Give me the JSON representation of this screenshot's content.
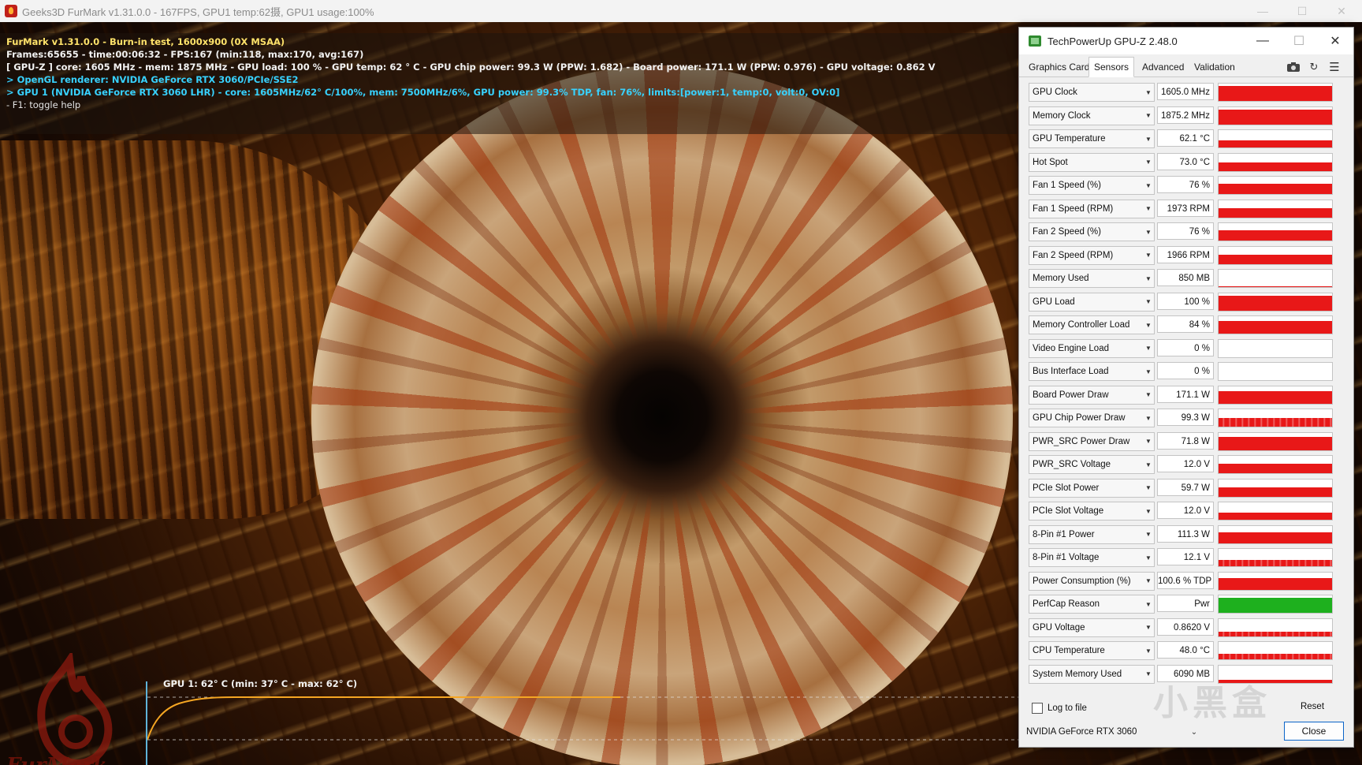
{
  "furmark": {
    "window_title": "Geeks3D FurMark v1.31.0.0 - 167FPS, GPU1 temp:62摄, GPU1 usage:100%",
    "osd": {
      "line1": "FurMark v1.31.0.0 - Burn-in test, 1600x900 (0X MSAA)",
      "line2": "Frames:65655 - time:00:06:32 - FPS:167 (min:118, max:170, avg:167)",
      "line3": "[ GPU-Z ] core: 1605 MHz - mem: 1875 MHz - GPU load: 100 % - GPU temp: 62 ° C - GPU chip power: 99.3 W (PPW: 1.682) - Board power: 171.1 W (PPW: 0.976) - GPU voltage: 0.862 V",
      "line4": "> OpenGL renderer: NVIDIA GeForce RTX 3060/PCIe/SSE2",
      "line5": "> GPU 1 (NVIDIA GeForce RTX 3060 LHR) - core: 1605MHz/62° C/100%, mem: 7500MHz/6%, GPU power: 99.3% TDP, fan: 76%, limits:[power:1, temp:0, volt:0, OV:0]",
      "line6": "- F1: toggle help"
    },
    "temp_graph_title": "GPU 1: 62° C (min: 37° C - max: 62° C)",
    "logo_text": "FurMark"
  },
  "gpuz": {
    "title": "TechPowerUp GPU-Z 2.48.0",
    "tabs": [
      "Graphics Card",
      "Sensors",
      "Advanced",
      "Validation"
    ],
    "active_tab": "Sensors",
    "sensors": [
      {
        "name": "GPU Clock",
        "value": "1605.0 MHz",
        "level": 0.95,
        "color": "#e81818",
        "noisy": false
      },
      {
        "name": "Memory Clock",
        "value": "1875.2 MHz",
        "level": 0.95,
        "color": "#e81818",
        "noisy": false
      },
      {
        "name": "GPU Temperature",
        "value": "62.1 °C",
        "level": 0.45,
        "color": "#e81818",
        "noisy": false
      },
      {
        "name": "Hot Spot",
        "value": "73.0 °C",
        "level": 0.55,
        "color": "#e81818",
        "noisy": false
      },
      {
        "name": "Fan 1 Speed (%)",
        "value": "76 %",
        "level": 0.65,
        "color": "#e81818",
        "noisy": false
      },
      {
        "name": "Fan 1 Speed (RPM)",
        "value": "1973 RPM",
        "level": 0.6,
        "color": "#e81818",
        "noisy": false
      },
      {
        "name": "Fan 2 Speed (%)",
        "value": "76 %",
        "level": 0.65,
        "color": "#e81818",
        "noisy": false
      },
      {
        "name": "Fan 2 Speed (RPM)",
        "value": "1966 RPM",
        "level": 0.6,
        "color": "#e81818",
        "noisy": false
      },
      {
        "name": "Memory Used",
        "value": "850 MB",
        "level": 0.07,
        "color": "#e81818",
        "noisy": false
      },
      {
        "name": "GPU Load",
        "value": "100 %",
        "level": 0.95,
        "color": "#e81818",
        "noisy": false
      },
      {
        "name": "Memory Controller Load",
        "value": "84 %",
        "level": 0.8,
        "color": "#e81818",
        "noisy": false
      },
      {
        "name": "Video Engine Load",
        "value": "0 %",
        "level": 0,
        "color": "#e81818",
        "noisy": false
      },
      {
        "name": "Bus Interface Load",
        "value": "0 %",
        "level": 0,
        "color": "#e81818",
        "noisy": false
      },
      {
        "name": "Board Power Draw",
        "value": "171.1 W",
        "level": 0.8,
        "color": "#e81818",
        "noisy": false
      },
      {
        "name": "GPU Chip Power Draw",
        "value": "99.3 W",
        "level": 0.55,
        "color": "#e81818",
        "noisy": true
      },
      {
        "name": "PWR_SRC Power Draw",
        "value": "71.8 W",
        "level": 0.85,
        "color": "#e81818",
        "noisy": false
      },
      {
        "name": "PWR_SRC Voltage",
        "value": "12.0 V",
        "level": 0.6,
        "color": "#e81818",
        "noisy": false
      },
      {
        "name": "PCIe Slot Power",
        "value": "59.7 W",
        "level": 0.6,
        "color": "#e81818",
        "noisy": false
      },
      {
        "name": "PCIe Slot Voltage",
        "value": "12.0 V",
        "level": 0.45,
        "color": "#e81818",
        "noisy": false
      },
      {
        "name": "8-Pin #1 Power",
        "value": "111.3 W",
        "level": 0.7,
        "color": "#e81818",
        "noisy": false
      },
      {
        "name": "8-Pin #1 Voltage",
        "value": "12.1 V",
        "level": 0.4,
        "color": "#e81818",
        "noisy": true
      },
      {
        "name": "Power Consumption (%)",
        "value": "100.6 % TDP",
        "level": 0.75,
        "color": "#e81818",
        "noisy": false
      },
      {
        "name": "PerfCap Reason",
        "value": "Pwr",
        "level": 0.95,
        "color": "#1eb01e",
        "noisy": false
      },
      {
        "name": "GPU Voltage",
        "value": "0.8620 V",
        "level": 0.3,
        "color": "#e81818",
        "noisy": true
      },
      {
        "name": "CPU Temperature",
        "value": "48.0 °C",
        "level": 0.35,
        "color": "#e81818",
        "noisy": true
      },
      {
        "name": "System Memory Used",
        "value": "6090 MB",
        "level": 0.2,
        "color": "#e81818",
        "noisy": false
      }
    ],
    "log_label": "Log to file",
    "reset_label": "Reset",
    "card_select": "NVIDIA GeForce RTX 3060",
    "close_label": "Close",
    "watermark": "小黑盒"
  }
}
